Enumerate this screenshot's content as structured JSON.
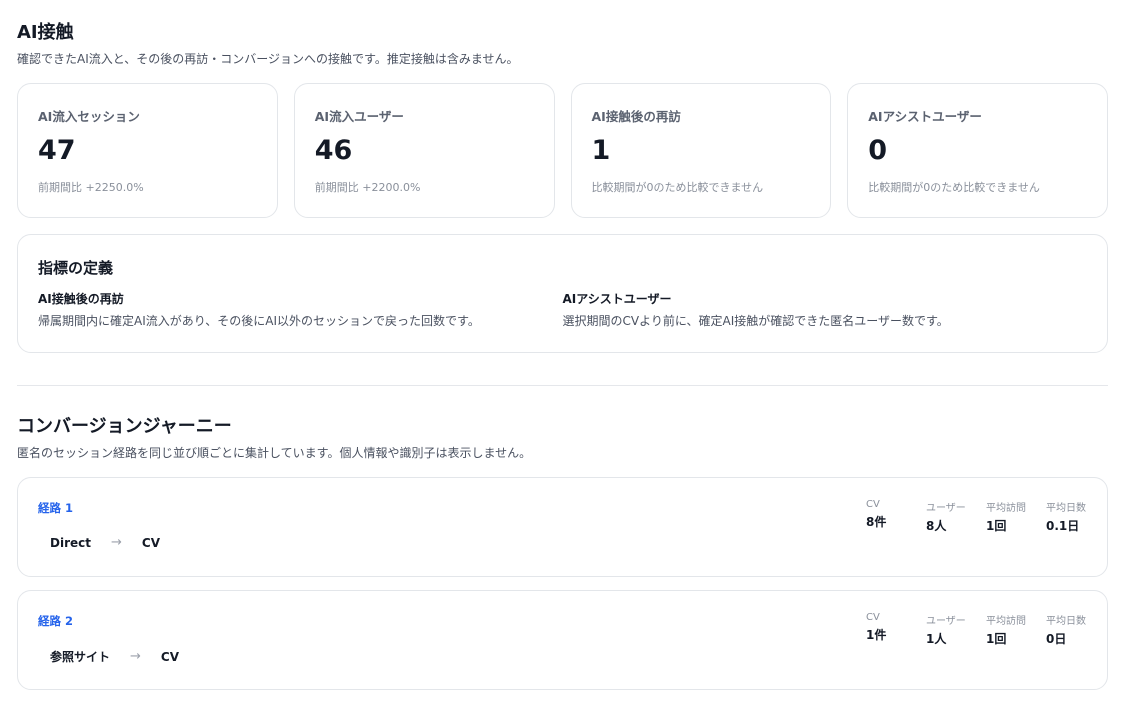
{
  "ai_contact": {
    "title": "AI接触",
    "description": "確認できたAI流入と、その後の再訪・コンバージョンへの接触です。推定接触は含みません。",
    "cards": [
      {
        "label": "AI流入セッション",
        "value": "47",
        "sub": "前期間比 +2250.0%"
      },
      {
        "label": "AI流入ユーザー",
        "value": "46",
        "sub": "前期間比 +2200.0%"
      },
      {
        "label": "AI接触後の再訪",
        "value": "1",
        "sub": "比較期間が0のため比較できません"
      },
      {
        "label": "AIアシストユーザー",
        "value": "0",
        "sub": "比較期間が0のため比較できません"
      }
    ]
  },
  "definitions": {
    "title": "指標の定義",
    "items": [
      {
        "term": "AI接触後の再訪",
        "desc": "帰属期間内に確定AI流入があり、その後にAI以外のセッションで戻った回数です。"
      },
      {
        "term": "AIアシストユーザー",
        "desc": "選択期間のCVより前に、確定AI接触が確認できた匿名ユーザー数です。"
      }
    ]
  },
  "journey": {
    "title": "コンバージョンジャーニー",
    "description": "匿名のセッション経路を同じ並び順ごとに集計しています。個人情報や識別子は表示しません。",
    "stat_labels": {
      "cv": "CV",
      "users": "ユーザー",
      "avg_visits": "平均訪問",
      "avg_days": "平均日数"
    },
    "arrow_icon": "→",
    "routes": [
      {
        "title": "経路 1",
        "from": "Direct",
        "to": "CV",
        "cv": "8件",
        "users": "8人",
        "avg_visits": "1回",
        "avg_days": "0.1日"
      },
      {
        "title": "経路 2",
        "from": "参照サイト",
        "to": "CV",
        "cv": "1件",
        "users": "1人",
        "avg_visits": "1回",
        "avg_days": "0日"
      }
    ]
  },
  "colors": {
    "accent": "#2563eb",
    "border": "#e3e6ea",
    "text": "#141a26",
    "muted": "#8a909b"
  }
}
